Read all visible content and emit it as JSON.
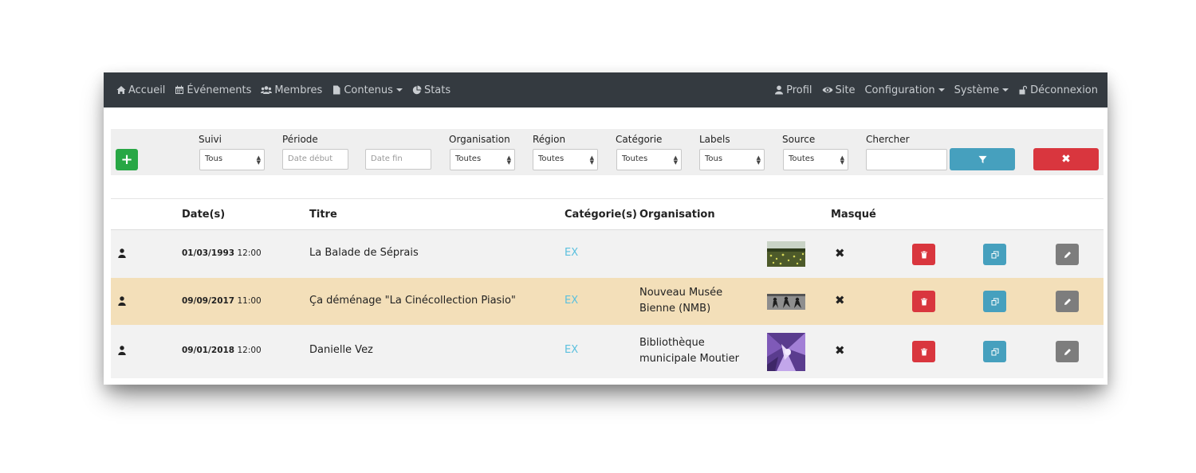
{
  "nav": {
    "left": [
      {
        "label": "Accueil",
        "icon": "home-icon"
      },
      {
        "label": "Événements",
        "icon": "calendar-icon"
      },
      {
        "label": "Membres",
        "icon": "users-icon"
      },
      {
        "label": "Contenus",
        "icon": "file-icon",
        "dropdown": true
      },
      {
        "label": "Stats",
        "icon": "pie-chart-icon"
      }
    ],
    "right": [
      {
        "label": "Profil",
        "icon": "user-icon"
      },
      {
        "label": "Site",
        "icon": "eye-icon"
      },
      {
        "label": "Configuration",
        "dropdown": true
      },
      {
        "label": "Système",
        "dropdown": true
      },
      {
        "label": "Déconnexion",
        "icon": "unlock-icon"
      }
    ]
  },
  "filters": {
    "add_label": "+",
    "suivi": {
      "label": "Suivi",
      "value": "Tous"
    },
    "periode": {
      "label": "Période",
      "start_placeholder": "Date début",
      "end_placeholder": "Date fin"
    },
    "organisation": {
      "label": "Organisation",
      "value": "Toutes"
    },
    "region": {
      "label": "Région",
      "value": "Toutes"
    },
    "categorie": {
      "label": "Catégorie",
      "value": "Toutes"
    },
    "labels": {
      "label": "Labels",
      "value": "Tous"
    },
    "source": {
      "label": "Source",
      "value": "Toutes"
    },
    "chercher": {
      "label": "Chercher",
      "value": ""
    },
    "clear_label": "✖"
  },
  "table": {
    "headers": {
      "dates": "Date(s)",
      "titre": "Titre",
      "categories": "Catégorie(s)",
      "organisation": "Organisation",
      "masque": "Masqué"
    },
    "rows": [
      {
        "date": "01/03/1993",
        "time": "12:00",
        "titre": "La Balade de Séprais",
        "categorie": "EX",
        "organisation": "",
        "masque": "✖",
        "highlight": false
      },
      {
        "date": "09/09/2017",
        "time": "11:00",
        "titre": "Ça déménage \"La Cinécollection Piasio\"",
        "categorie": "EX",
        "organisation": "Nouveau Musée Bienne (NMB)",
        "masque": "✖",
        "highlight": true
      },
      {
        "date": "09/01/2018",
        "time": "12:00",
        "titre": "Danielle Vez",
        "categorie": "EX",
        "organisation": "Bibliothèque municipale Moutier",
        "masque": "✖",
        "highlight": false
      }
    ]
  },
  "colors": {
    "navbar": "#343a40",
    "highlight_row": "#f3dfb9",
    "add": "#28a745",
    "filter": "#46a0be",
    "danger": "#d9363e",
    "edit": "#7d7d7d",
    "category_link": "#5bc0de"
  }
}
